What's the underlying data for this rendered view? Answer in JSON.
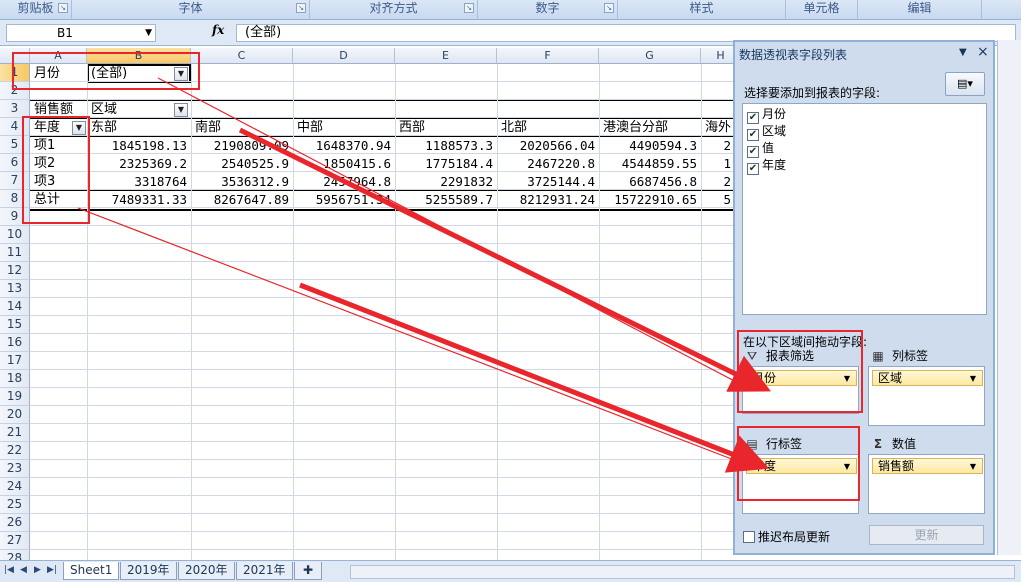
{
  "ribbon": {
    "groups": [
      "剪贴板",
      "字体",
      "对齐方式",
      "数字",
      "样式",
      "单元格",
      "编辑"
    ]
  },
  "formula_bar": {
    "name_box": "B1",
    "fx": "fx",
    "formula": "(全部)"
  },
  "grid": {
    "columns": [
      "A",
      "B",
      "C",
      "D",
      "E",
      "F",
      "G",
      "H"
    ],
    "rows": [
      "1",
      "2",
      "3",
      "4",
      "5",
      "6",
      "7",
      "8",
      "9",
      "10",
      "11",
      "12",
      "13",
      "14",
      "15",
      "16",
      "17",
      "18",
      "19",
      "20",
      "21",
      "22",
      "23",
      "24",
      "25",
      "26",
      "27",
      "28"
    ],
    "filter": {
      "label": "月份",
      "value": "(全部)"
    },
    "pivot_header": {
      "value_label": "销售额",
      "column_label": "区域",
      "row_label": "年度"
    },
    "regions": [
      "东部",
      "南部",
      "中部",
      "西部",
      "北部",
      "港澳台分部",
      "海外"
    ],
    "data_rows": [
      {
        "label": "项1",
        "values": [
          "1845198.13",
          "2190809.09",
          "1648370.94",
          "1188573.3",
          "2020566.04",
          "4490594.3",
          "2"
        ]
      },
      {
        "label": "项2",
        "values": [
          "2325369.2",
          "2540525.9",
          "1850415.6",
          "1775184.4",
          "2467220.8",
          "4544859.55",
          "1"
        ]
      },
      {
        "label": "项3",
        "values": [
          "3318764",
          "3536312.9",
          "2457964.8",
          "2291832",
          "3725144.4",
          "6687456.8",
          "2"
        ]
      },
      {
        "label": "总计",
        "values": [
          "7489331.33",
          "8267647.89",
          "5956751.34",
          "5255589.7",
          "8212931.24",
          "15722910.65",
          "5"
        ]
      }
    ]
  },
  "sheet_tabs": [
    "Sheet1",
    "2019年",
    "2020年",
    "2021年"
  ],
  "pivot_pane": {
    "title": "数据透视表字段列表",
    "choose_label": "选择要添加到报表的字段:",
    "fields": [
      {
        "name": "月份",
        "checked": true
      },
      {
        "name": "区域",
        "checked": true
      },
      {
        "name": "值",
        "checked": true
      },
      {
        "name": "年度",
        "checked": true
      }
    ],
    "drag_label": "在以下区域间拖动字段:",
    "areas": {
      "filter": {
        "title": "报表筛选",
        "chip": "月份"
      },
      "columns": {
        "title": "列标签",
        "chip": "区域"
      },
      "rows": {
        "title": "行标签",
        "chip": "年度"
      },
      "values": {
        "title": "数值",
        "chip": "销售额"
      }
    },
    "defer_label": "推迟布局更新",
    "update_button": "更新"
  },
  "colors": {
    "annotation_red": "#e8262c",
    "selected_header": "#f8c862",
    "chip_fill": "#fde8a0"
  }
}
